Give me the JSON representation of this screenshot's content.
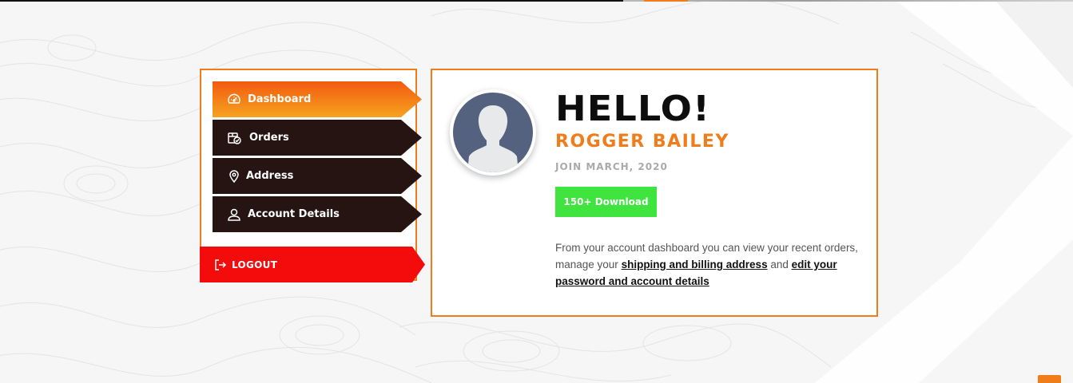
{
  "colors": {
    "accent": "#f07c1a",
    "dark_nav": "#261413",
    "logout": "#f40c0c",
    "badge": "#3fe43f",
    "avatar_bg": "#55627f"
  },
  "sidebar": {
    "items": [
      {
        "label": "Dashboard",
        "icon": "gauge-icon",
        "active": true
      },
      {
        "label": "Orders",
        "icon": "box-check-icon",
        "active": false
      },
      {
        "label": "Address",
        "icon": "map-pin-icon",
        "active": false
      },
      {
        "label": "Account Details",
        "icon": "user-icon",
        "active": false
      }
    ],
    "logout": {
      "label": "LOGOUT",
      "icon": "logout-icon"
    }
  },
  "profile": {
    "greeting": "HELLO!",
    "name": "ROGGER BAILEY",
    "join": "JOIN MARCH, 2020",
    "badge": "150+ Download",
    "desc_before": "From your account dashboard you can view your recent orders, manage your ",
    "link1": "shipping and billing address",
    "desc_middle": " and ",
    "link2": "edit your password and account details"
  }
}
